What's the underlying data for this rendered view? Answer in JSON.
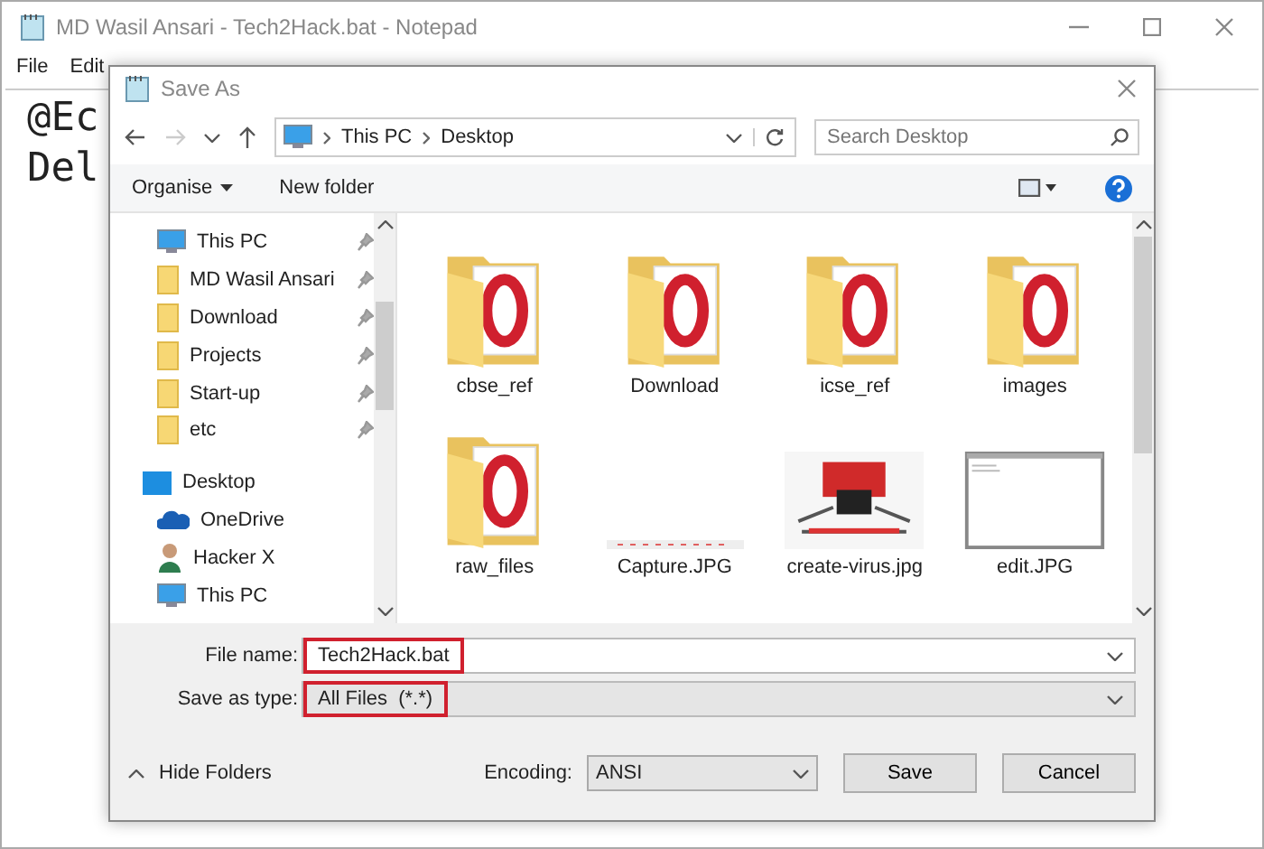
{
  "notepad": {
    "title": "MD Wasil Ansari - Tech2Hack.bat - Notepad",
    "menu": [
      "File",
      "Edit"
    ],
    "lines": [
      "@Ec",
      "Del"
    ]
  },
  "dialog": {
    "title": "Save As",
    "path": [
      "This PC",
      "Desktop"
    ],
    "search": {
      "placeholder": "Search Desktop"
    },
    "toolbar": [
      "Organise",
      "New folder"
    ],
    "sidebar": [
      {
        "label": "This PC",
        "kind": "pc",
        "pinned": true
      },
      {
        "label": "MD Wasil Ansari",
        "kind": "folder",
        "pinned": true
      },
      {
        "label": "Download",
        "kind": "folder",
        "pinned": true
      },
      {
        "label": "Projects",
        "kind": "folder",
        "pinned": true
      },
      {
        "label": "Start-up",
        "kind": "folder",
        "pinned": true
      },
      {
        "label": "etc",
        "kind": "folder",
        "pinned": true
      },
      {
        "label": "Desktop",
        "kind": "desktop",
        "pinned": false
      },
      {
        "label": "OneDrive",
        "kind": "cloud",
        "pinned": false
      },
      {
        "label": "Hacker X",
        "kind": "user",
        "pinned": false
      },
      {
        "label": "This PC",
        "kind": "pc",
        "pinned": false
      }
    ],
    "files": [
      {
        "name": "cbse_ref",
        "kind": "folder"
      },
      {
        "name": "Download",
        "kind": "folder"
      },
      {
        "name": "icse_ref",
        "kind": "folder"
      },
      {
        "name": "images",
        "kind": "folder"
      },
      {
        "name": "raw_files",
        "kind": "folder"
      },
      {
        "name": "Capture.JPG",
        "kind": "strip"
      },
      {
        "name": "create-virus.jpg"
      },
      {
        "name": "edit.JPG",
        "kind": "screen"
      }
    ],
    "file_name": {
      "label": "File name:",
      "value": "Tech2Hack.bat",
      "highlighted": true
    },
    "save_type": {
      "label": "Save as type:",
      "value": "All Files  (*.*)",
      "highlighted": true
    },
    "hide_folders": "Hide Folders",
    "encoding": {
      "label": "Encoding:",
      "value": "ANSI"
    },
    "buttons": [
      "Save",
      "Cancel"
    ]
  }
}
